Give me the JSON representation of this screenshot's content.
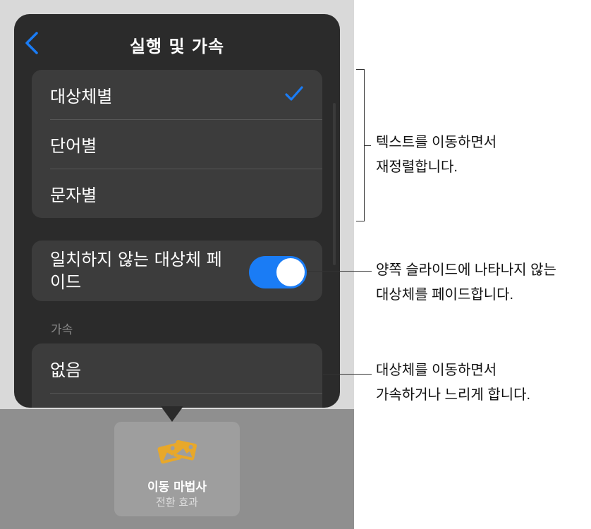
{
  "nav": {
    "title": "실행 및 가속",
    "back_icon": "chevron-left-icon"
  },
  "delivery_options": [
    {
      "label": "대상체별",
      "selected": true
    },
    {
      "label": "단어별",
      "selected": false
    },
    {
      "label": "문자별",
      "selected": false
    }
  ],
  "fade_toggle": {
    "label": "일치하지 않는 대상체 페이드",
    "on": true
  },
  "acceleration": {
    "header": "가속",
    "options": [
      {
        "label": "없음"
      }
    ]
  },
  "transition_tile": {
    "icon": "photos-icon",
    "name": "이동 마법사",
    "subtitle": "전환 효과"
  },
  "callouts": {
    "delivery": "텍스트를 이동하면서\n재정렬합니다.",
    "fade": "양쪽 슬라이드에 나타나지 않는\n대상체를 페이드합니다.",
    "acceleration": "대상체를 이동하면서\n가속하거나 느리게 합니다."
  },
  "colors": {
    "accent": "#1a7cf5",
    "popover_bg": "#2b2b2b",
    "row_bg": "#3c3c3c",
    "tile_icon": "#e8a82a"
  }
}
